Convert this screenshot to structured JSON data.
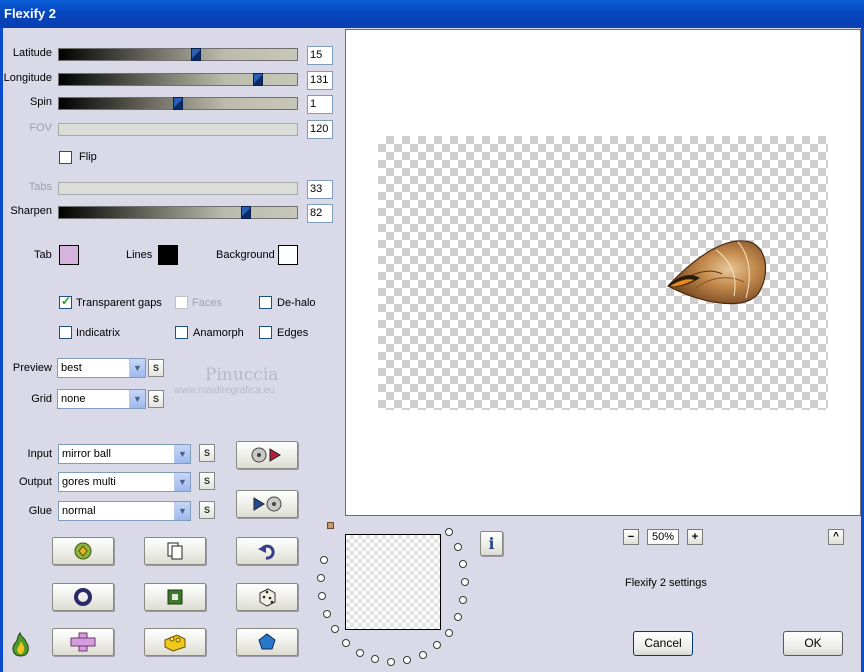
{
  "window": {
    "title": "Flexify 2"
  },
  "colors": {
    "tab": "#d6b3dc",
    "lines": "#000000",
    "background": "#ffffff"
  },
  "sliders": {
    "latitude": {
      "label": "Latitude",
      "value": "15",
      "level": 0.58
    },
    "longitude": {
      "label": "Longitude",
      "value": "131",
      "level": 0.85
    },
    "spin": {
      "label": "Spin",
      "value": "1",
      "level": 0.5
    },
    "fov": {
      "label": "FOV",
      "value": "120"
    },
    "tabs": {
      "label": "Tabs",
      "value": "33"
    },
    "sharpen": {
      "label": "Sharpen",
      "value": "82",
      "level": 0.8
    }
  },
  "flip": {
    "label": "Flip",
    "checked": false
  },
  "swatches": {
    "tab_label": "Tab",
    "lines_label": "Lines",
    "background_label": "Background"
  },
  "options": {
    "transparent_gaps": {
      "label": "Transparent gaps",
      "checked": true
    },
    "faces": {
      "label": "Faces",
      "checked": false
    },
    "dehalo": {
      "label": "De-halo",
      "checked": false
    },
    "indicatrix": {
      "label": "Indicatrix",
      "checked": false
    },
    "anamorph": {
      "label": "Anamorph",
      "checked": false
    },
    "edges": {
      "label": "Edges",
      "checked": false
    }
  },
  "preview_select": {
    "label": "Preview",
    "value": "best"
  },
  "grid_select": {
    "label": "Grid",
    "value": "none"
  },
  "input_select": {
    "label": "Input",
    "value": "mirror ball"
  },
  "output_select": {
    "label": "Output",
    "value": "gores multi"
  },
  "glue_select": {
    "label": "Glue",
    "value": "normal"
  },
  "s_button": "S",
  "watermark": {
    "name": "Pinuccia",
    "url": "www.maidiregrafica.eu"
  },
  "zoom": {
    "value": "50%",
    "minus": "−",
    "plus": "+"
  },
  "settings_label": "Flexify 2 settings",
  "info": "i",
  "collapse": "^",
  "buttons": {
    "cancel": "Cancel",
    "ok": "OK"
  },
  "icons": {
    "input_to_output": "disc-to-arrow-icon",
    "output_to_input": "arrow-to-disc-icon",
    "randomize": "randomize-icon",
    "copy": "copy-icon",
    "undo": "undo-icon",
    "ring": "ring-icon",
    "square": "square-icon",
    "dice": "dice-icon",
    "cross": "cross-icon",
    "brick": "brick-icon",
    "pentagon": "pentagon-icon",
    "logo": "flaming-pear-icon"
  }
}
